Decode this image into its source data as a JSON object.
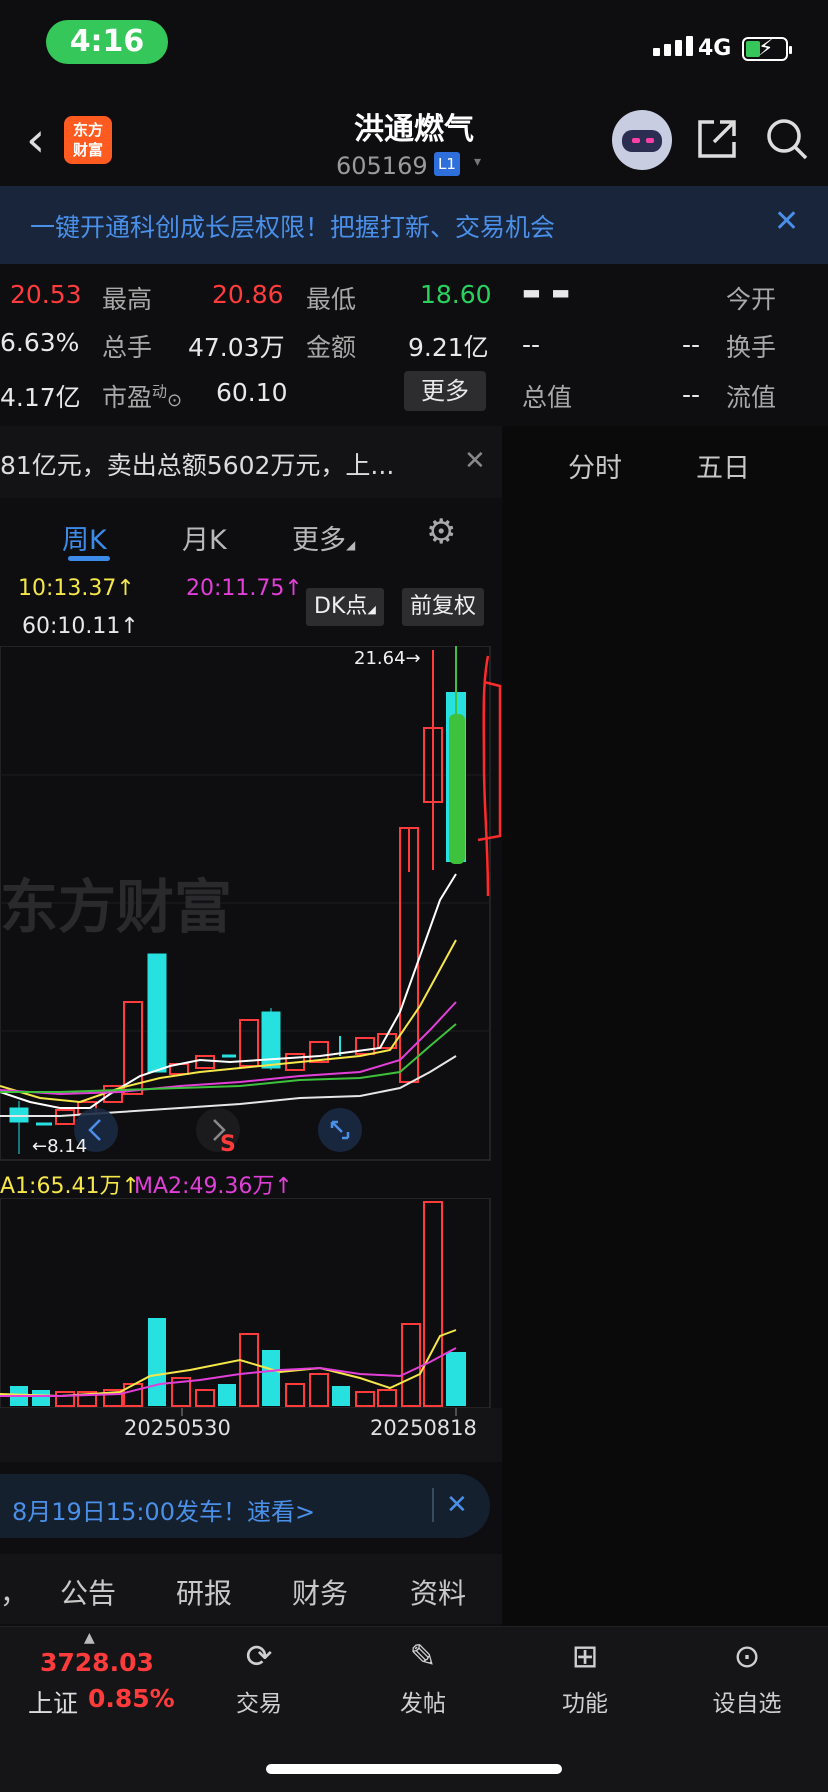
{
  "status": {
    "time": "4:16",
    "network": "4G"
  },
  "header": {
    "back": "‹",
    "logo": "东方\n财富",
    "name": "洪通燃气",
    "code": "605169",
    "level": "L1",
    "caret": "▾"
  },
  "banner": {
    "text": "一键开通科创成长层权限！把握打新、交易机会",
    "close": "✕"
  },
  "quote": {
    "r1": {
      "v1": "20.53",
      "l_high": "最高",
      "high": "20.86",
      "l_low": "最低",
      "low": "18.60",
      "dash": "▬ ▬",
      "l_open": "今开"
    },
    "r2": {
      "v1": "6.63%",
      "l_vol": "总手",
      "vol": "47.03万",
      "l_amt": "金额",
      "amt": "9.21亿",
      "d1": "--",
      "d2": "--",
      "l_turn": "换手"
    },
    "r3": {
      "v1": "4.17亿",
      "l_pe": "市盈",
      "pe_sup": "动",
      "pe": "60.10",
      "more": "更多",
      "l_mcap": "总值",
      "d3": "--",
      "l_float": "流值"
    }
  },
  "news": {
    "text": "81亿元，卖出总额5602万元，上...",
    "close": "✕"
  },
  "right_tabs": [
    "分时",
    "五日"
  ],
  "period_tabs": {
    "week": "周K",
    "month": "月K",
    "more": "更多",
    "more_caret": "◢"
  },
  "chart_labels": {
    "ma10": "10:13.37↑",
    "ma20": "20:11.75↑",
    "ma60": "60:10.11↑",
    "dk": "DK点",
    "dk_caret": "◢",
    "adj": "前复权",
    "high_mark": "21.64→",
    "low_mark": "←8.14",
    "watermark": "东方财富",
    "s_mark": "S",
    "vol_ma1": "A1:65.41万↑",
    "vol_ma2": "MA2:49.36万↑",
    "date1": "20250530",
    "date2": "20250818"
  },
  "chart_data": {
    "type": "candlestick",
    "period": "weekly",
    "high_label": 21.64,
    "low_label": 8.14,
    "ma": {
      "MA10": 13.37,
      "MA20": 11.75,
      "MA60": 10.11
    },
    "volume_ma": {
      "MA1": "65.41万",
      "MA2": "49.36万"
    },
    "x_ticks": [
      "20250530",
      "20250818"
    ],
    "colors": {
      "up": "#ff3b3b",
      "down": "#27e0e0",
      "ma10": "#ffffff",
      "ma20": "#f5e64a",
      "ma60": "#e23fd8",
      "extra1": "#3ec23e",
      "extra2": "#e6e6e6"
    }
  },
  "notice": {
    "text": "8月19日15:00发车！速看>",
    "close": "✕"
  },
  "bottom_tabs": [
    "，",
    "公告",
    "研报",
    "财务",
    "资料"
  ],
  "toolbar": {
    "index_value": "3728.03",
    "index_name": "上证",
    "index_change": "0.85%",
    "items": [
      {
        "icon": "trade-icon",
        "label": "交易"
      },
      {
        "icon": "post-icon",
        "label": "发帖"
      },
      {
        "icon": "function-icon",
        "label": "功能"
      },
      {
        "icon": "watchlist-icon",
        "label": "设自选"
      }
    ]
  }
}
